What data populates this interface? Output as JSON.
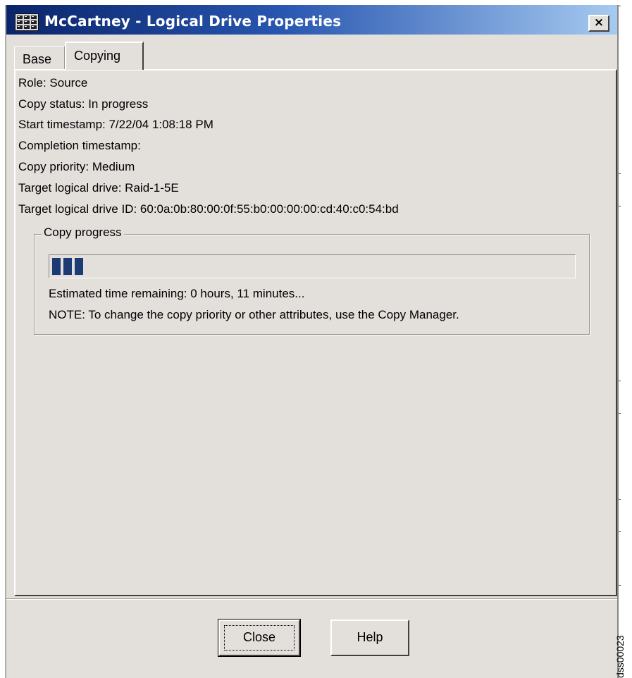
{
  "window": {
    "title": "McCartney - Logical Drive Properties",
    "close_glyph": "×",
    "title_icon": "server-grid-icon"
  },
  "tabs": [
    {
      "label": "Base",
      "selected": false
    },
    {
      "label": "Copying",
      "selected": true
    }
  ],
  "info": {
    "role": "Role: Source",
    "copy_status": "Copy status: In progress",
    "start_timestamp": "Start timestamp: 7/22/04 1:08:18 PM",
    "completion_timestamp": "Completion timestamp:",
    "copy_priority": "Copy priority: Medium",
    "target_drive": "Target logical drive: Raid-1-5E",
    "target_drive_id": "Target logical drive ID: 60:0a:0b:80:00:0f:55:b0:00:00:00:cd:40:c0:54:bd"
  },
  "copy_progress": {
    "legend": "Copy progress",
    "chunks_filled": 3,
    "estimated_time": "Estimated time remaining: 0 hours, 11 minutes...",
    "note": "NOTE: To change the copy priority or other attributes, use the Copy Manager."
  },
  "buttons": {
    "close_label": "Close",
    "help_label": "Help"
  },
  "watermark": "dss00023",
  "colors": {
    "title_gradient_start": "#0a246a",
    "title_gradient_end": "#a6caf0",
    "progress_fill": "#1c3a73",
    "face": "#e3e0dc"
  }
}
